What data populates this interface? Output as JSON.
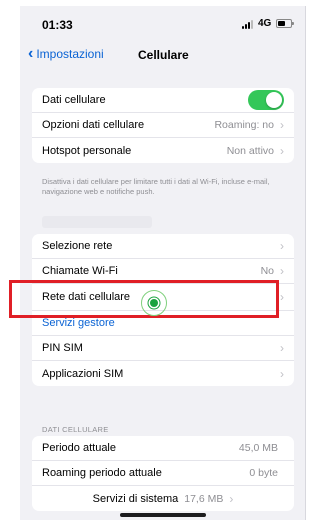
{
  "status_bar": {
    "time": "01:33",
    "network": "4G"
  },
  "nav": {
    "back_label": "Impostazioni",
    "title": "Cellulare"
  },
  "group1": {
    "items": [
      {
        "label": "Dati cellulare",
        "toggle_on": true
      },
      {
        "label": "Opzioni dati cellulare",
        "value": "Roaming: no"
      },
      {
        "label": "Hotspot personale",
        "value": "Non attivo"
      }
    ]
  },
  "footnote": "Disattiva i dati cellulare per limitare tutti i dati al Wi-Fi, incluse e-mail, navigazione web e notifiche push.",
  "group2": {
    "items": [
      {
        "label": "Selezione rete",
        "value": ""
      },
      {
        "label": "Chiamate Wi-Fi",
        "value": "No"
      },
      {
        "label": "Rete dati cellulare",
        "value": ""
      },
      {
        "label": "Servizi gestore"
      },
      {
        "label": "PIN SIM",
        "value": ""
      },
      {
        "label": "Applicazioni SIM",
        "value": ""
      }
    ]
  },
  "data_section": {
    "header": "DATI CELLULARE",
    "items": [
      {
        "label": "Periodo attuale",
        "value": "45,0 MB"
      },
      {
        "label": "Roaming periodo attuale",
        "value": "0 byte"
      },
      {
        "label": "Servizi di sistema",
        "value": "17,6 MB"
      }
    ]
  },
  "colors": {
    "accent": "#0a63d4",
    "toggle": "#34c759",
    "highlight": "#e01f26",
    "marker": "#1aa33f"
  }
}
